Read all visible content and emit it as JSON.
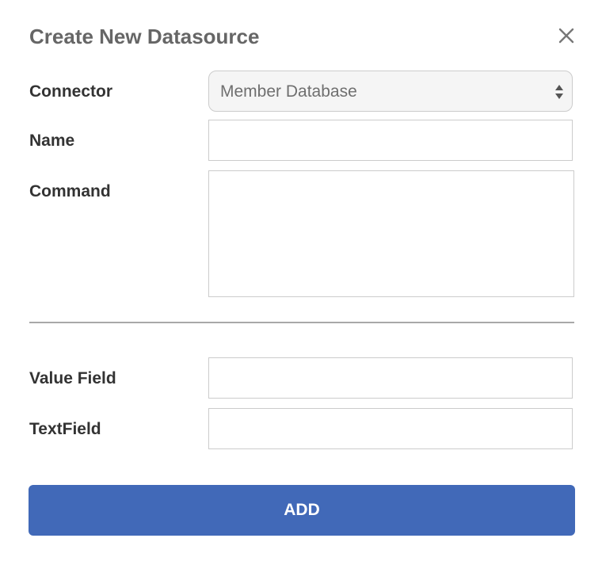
{
  "dialog": {
    "title": "Create New Datasource",
    "close_icon": "close-icon"
  },
  "form": {
    "connector": {
      "label": "Connector",
      "selected": "Member Database"
    },
    "name": {
      "label": "Name",
      "value": ""
    },
    "command": {
      "label": "Command",
      "value": ""
    },
    "value_field": {
      "label": "Value Field",
      "value": ""
    },
    "text_field": {
      "label": "TextField",
      "value": ""
    }
  },
  "actions": {
    "add_label": "ADD"
  },
  "colors": {
    "accent": "#4169b8",
    "title": "#666666",
    "label": "#333333",
    "border": "#cccccc",
    "select_bg": "#f5f5f5"
  }
}
